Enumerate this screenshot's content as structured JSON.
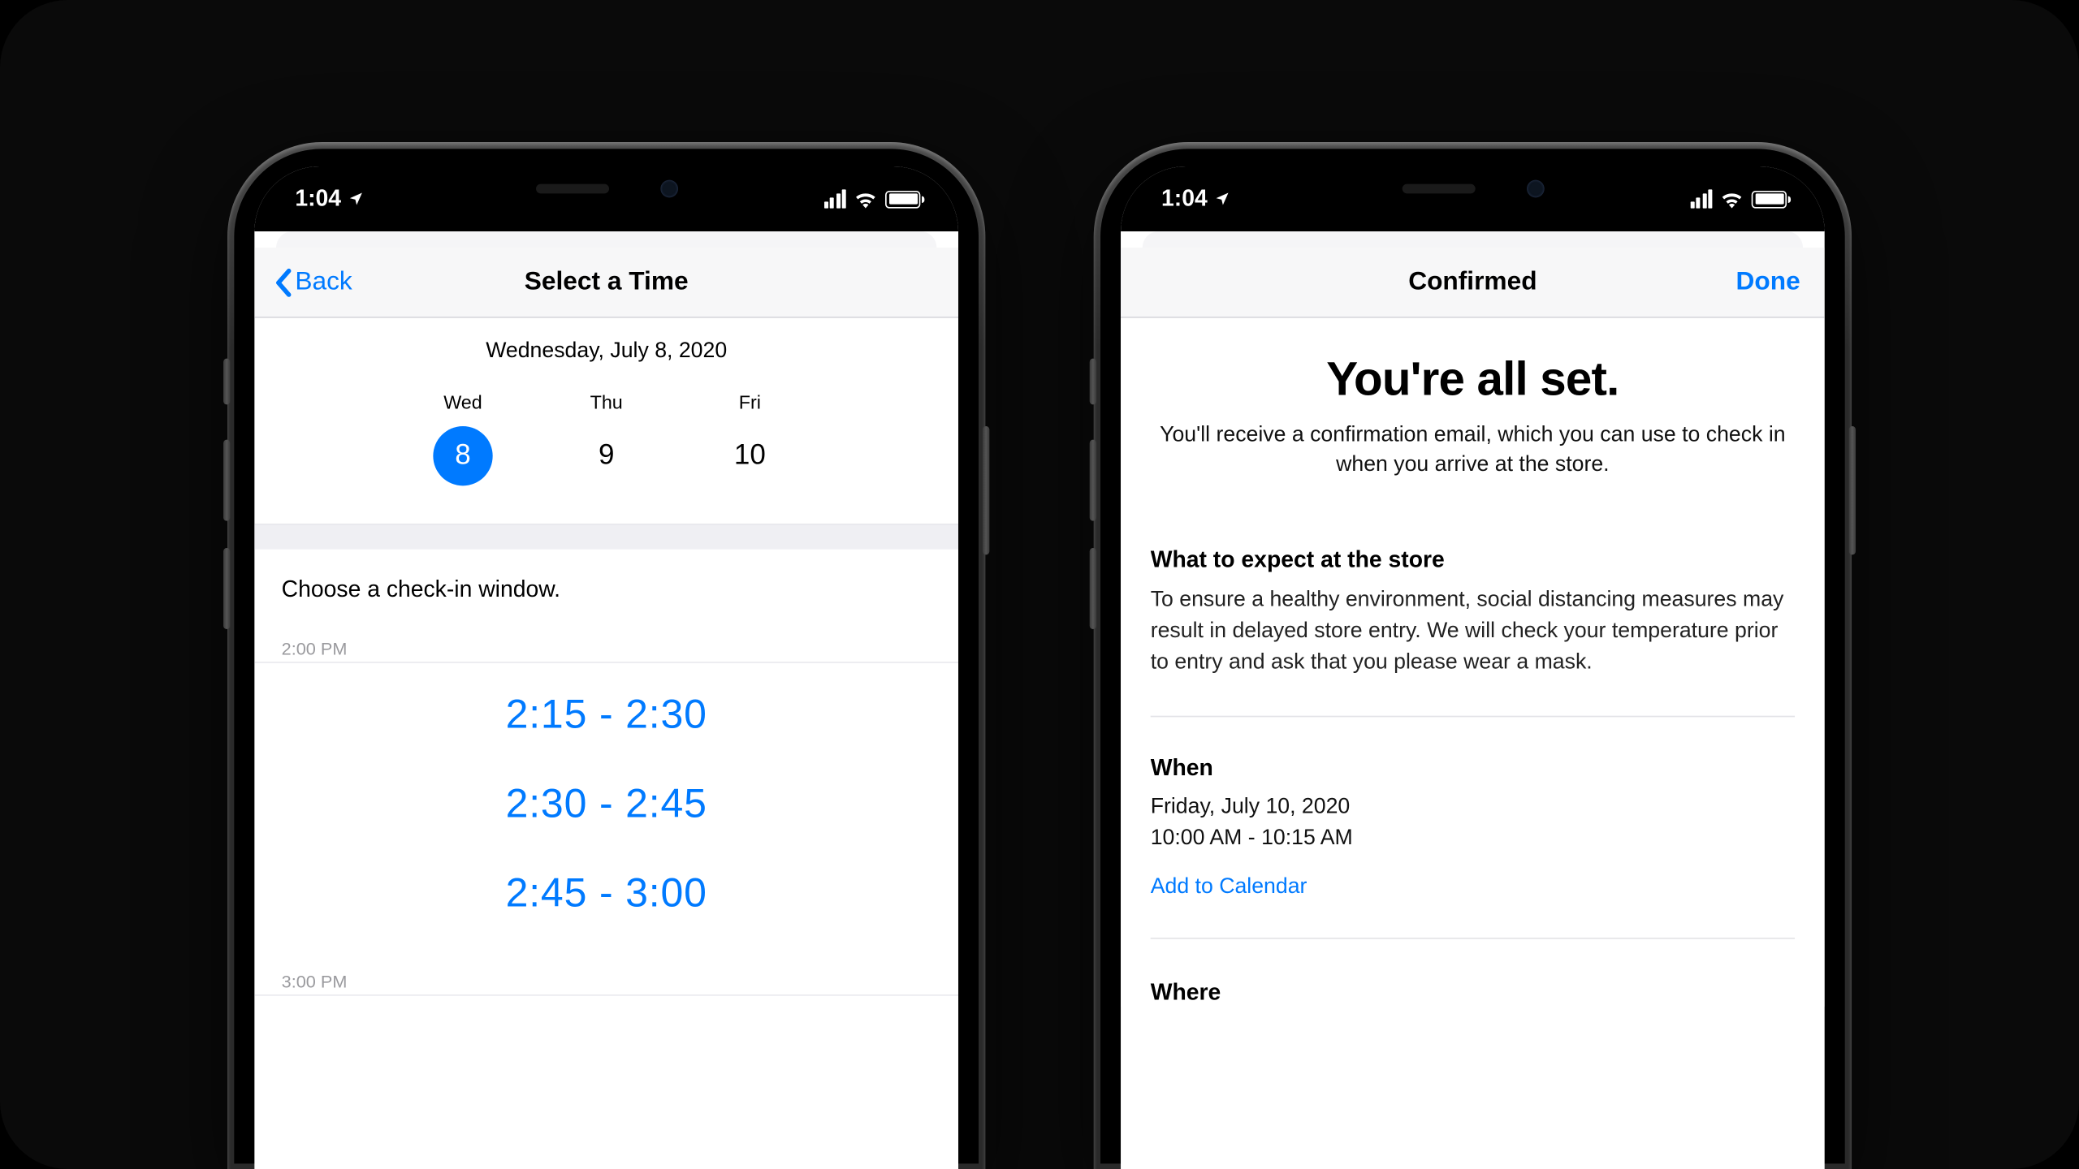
{
  "status": {
    "time": "1:04"
  },
  "left": {
    "nav": {
      "back": "Back",
      "title": "Select a Time"
    },
    "dateHeader": "Wednesday, July 8, 2020",
    "days": [
      {
        "abbr": "Wed",
        "num": "8",
        "selected": true
      },
      {
        "abbr": "Thu",
        "num": "9",
        "selected": false
      },
      {
        "abbr": "Fri",
        "num": "10",
        "selected": false
      }
    ],
    "chooseLabel": "Choose a check-in window.",
    "hourLabel1": "2:00 PM",
    "slots": [
      "2:15 - 2:30",
      "2:30 - 2:45",
      "2:45 - 3:00"
    ],
    "hourLabel2": "3:00 PM"
  },
  "right": {
    "nav": {
      "title": "Confirmed",
      "done": "Done"
    },
    "heroTitle": "You're all set.",
    "heroBody": "You'll receive a confirmation email, which you can use to check in when you arrive at the store.",
    "expectHeading": "What to expect at the store",
    "expectBody": "To ensure a healthy environment, social distancing measures may result in delayed store entry. We will check your temperature prior to entry and ask that you please wear a mask.",
    "whenHeading": "When",
    "whenDate": "Friday, July 10, 2020",
    "whenTime": "10:00 AM - 10:15 AM",
    "calendarLink": "Add to Calendar",
    "whereHeading": "Where"
  }
}
